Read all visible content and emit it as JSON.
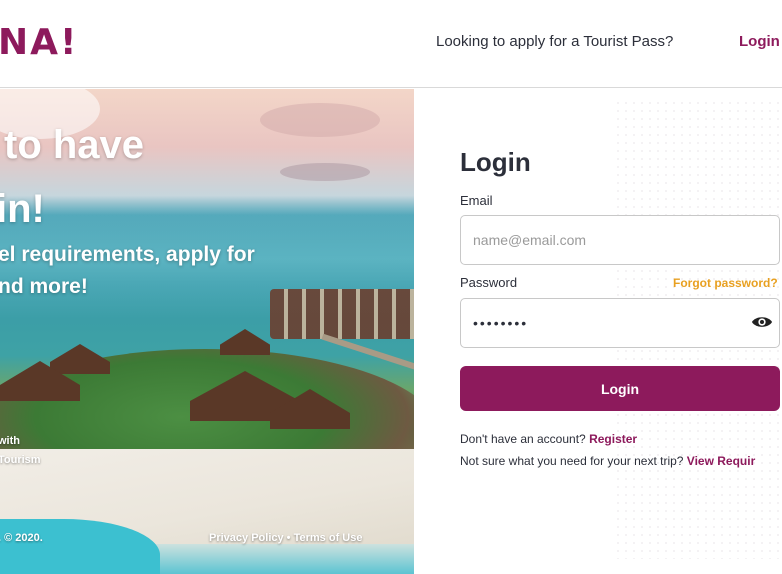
{
  "header": {
    "logo_text": "NA!",
    "tourist_pass_link": "Looking to apply for a Tourist Pass?",
    "login_link": "Login"
  },
  "hero": {
    "title_line1": "to have",
    "title_line2": "in!",
    "subtitle_line1": "el requirements, apply for",
    "subtitle_line2": "nd more!",
    "with_line1": "with",
    "with_line2": "Tourism",
    "copyright": ". © 2020.",
    "privacy_link": "Privacy Policy",
    "separator": "•",
    "terms_link": "Terms of Use"
  },
  "form": {
    "title": "Login",
    "email_label": "Email",
    "email_placeholder": "name@email.com",
    "password_label": "Password",
    "forgot_password": "Forgot password?",
    "password_value": "••••••••",
    "login_button": "Login",
    "no_account_text": "Don't have an account?",
    "register_link": "Register",
    "not_sure_text": "Not sure what you need for your next trip?",
    "view_requirements_link": "View Requir"
  },
  "colors": {
    "brand": "#8d1a5c",
    "accent_orange": "#e8a021",
    "text_dark": "#2c2f3a"
  },
  "icons": {
    "password_toggle": "eye-icon"
  }
}
